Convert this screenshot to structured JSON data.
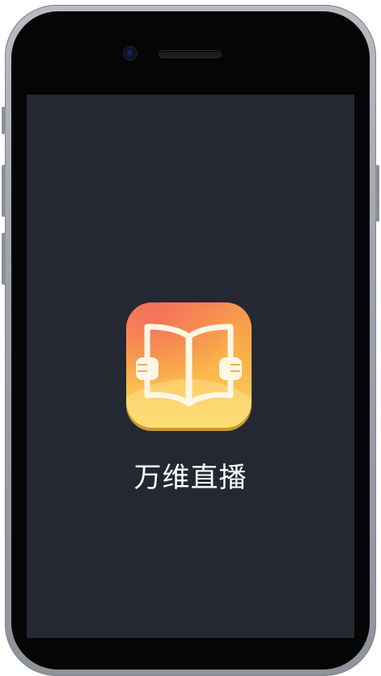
{
  "app": {
    "name": "万维直播",
    "icon": "open-book-icon"
  },
  "colors": {
    "screen_background": "#242833",
    "icon_gradient_top": "#f7934f",
    "icon_gradient_bottom": "#fdd45c",
    "text": "#ffffff"
  }
}
